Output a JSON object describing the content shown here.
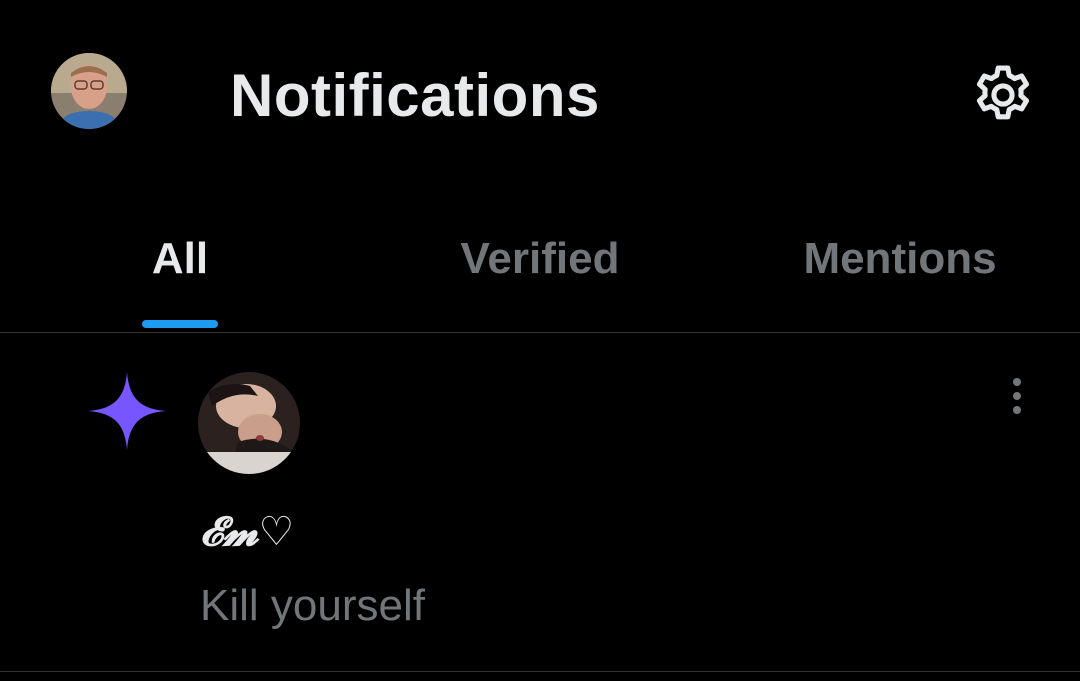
{
  "header": {
    "title": "Notifications",
    "avatar_icon": "user-avatar",
    "settings_icon": "gear-icon"
  },
  "tabs": [
    {
      "label": "All",
      "active": true
    },
    {
      "label": "Verified",
      "active": false
    },
    {
      "label": "Mentions",
      "active": false
    }
  ],
  "notification": {
    "type_icon": "sparkle-icon",
    "type_icon_color": "#7856ff",
    "author_name": "𝓔𝓶♡",
    "text": "Kill yourself",
    "more_icon": "more-vertical-icon"
  },
  "colors": {
    "background": "#000000",
    "primary_text": "#e7e9ea",
    "secondary_text": "#71767b",
    "accent": "#1d9bf0",
    "divider": "#2f3336"
  }
}
